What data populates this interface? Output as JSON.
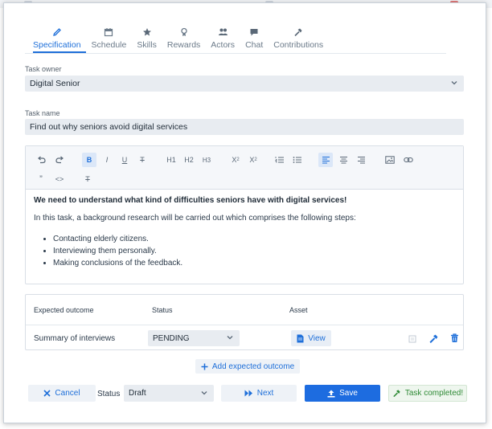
{
  "tabs": [
    {
      "label": "Specification",
      "icon": "pencil-icon",
      "active": true
    },
    {
      "label": "Schedule",
      "icon": "calendar-icon"
    },
    {
      "label": "Skills",
      "icon": "star-icon"
    },
    {
      "label": "Rewards",
      "icon": "award-icon"
    },
    {
      "label": "Actors",
      "icon": "users-icon"
    },
    {
      "label": "Chat",
      "icon": "chat-icon"
    },
    {
      "label": "Contributions",
      "icon": "hammer-icon"
    }
  ],
  "task_owner": {
    "label": "Task owner",
    "value": "Digital Senior"
  },
  "task_name": {
    "label": "Task name",
    "value": "Find out why seniors avoid digital services"
  },
  "toolbar": {
    "h1": "H1",
    "h2": "H2",
    "h3": "H3",
    "sub": "X",
    "sub_mark": "2",
    "sup": "X",
    "sup_mark": "2",
    "bold": "B",
    "italic": "I",
    "underline": "U",
    "strike": "T",
    "quote": "”",
    "code": "<>",
    "clear": "T"
  },
  "content": {
    "lead": "We need to understand what kind of difficulties seniors have with digital services!",
    "paragraph": "In this task, a background research will be carried out which comprises the following steps:",
    "steps": [
      "Contacting elderly citizens.",
      "Interviewing them personally.",
      "Making conclusions of the feedback."
    ]
  },
  "outcomes": {
    "headers": {
      "outcome": "Expected outcome",
      "status": "Status",
      "asset": "Asset"
    },
    "rows": [
      {
        "outcome": "Summary of interviews",
        "status": "PENDING",
        "asset_button": "View"
      }
    ]
  },
  "add_outcome_label": "Add expected outcome",
  "footer": {
    "cancel": "Cancel",
    "status_label": "Status",
    "status_value": "Draft",
    "next": "Next",
    "save": "Save",
    "completed": "Task completed!"
  },
  "colors": {
    "accent": "#1e6fd9",
    "save_bg": "#1d6ce0",
    "success": "#2f8a36",
    "danger": "#1e6fd9"
  }
}
